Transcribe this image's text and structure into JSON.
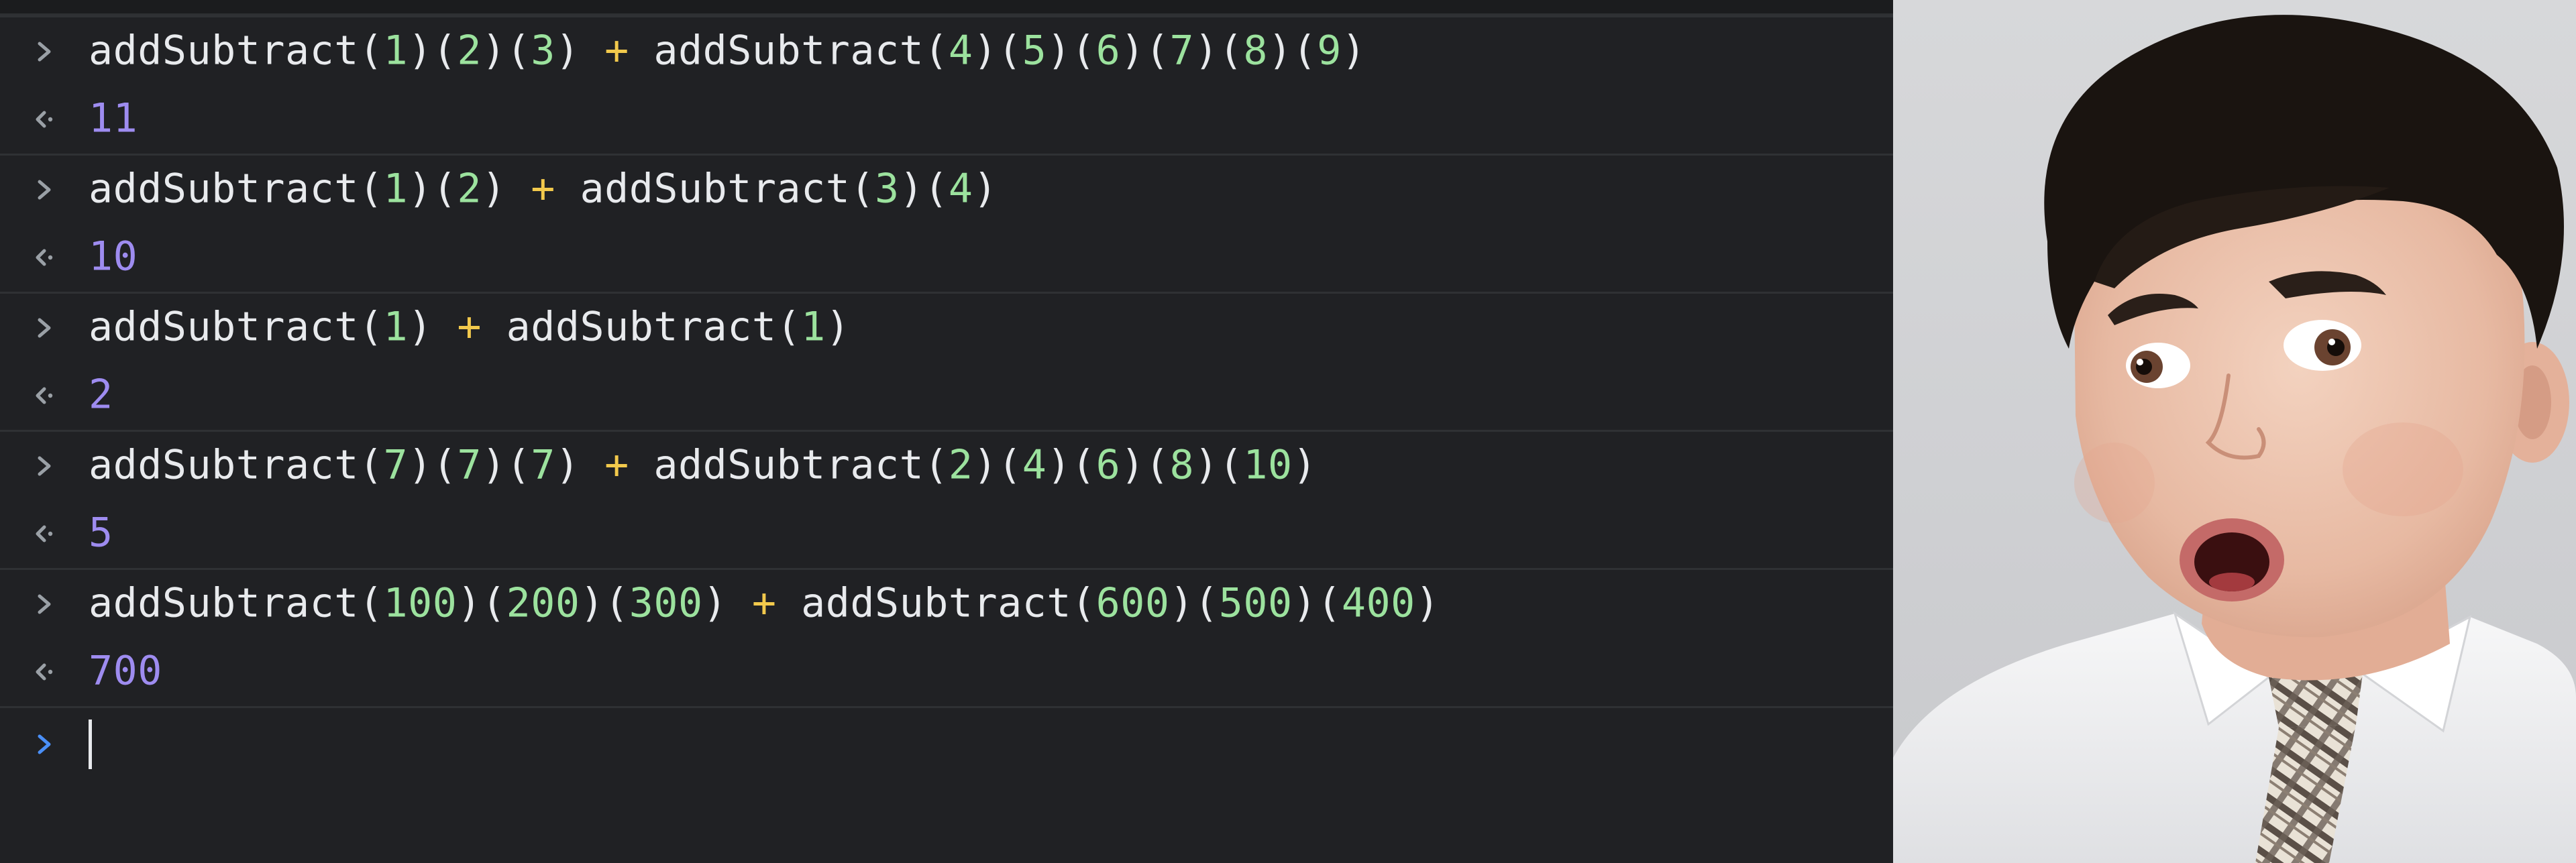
{
  "console": {
    "entries": [
      {
        "input": [
          {
            "t": "fn",
            "v": "addSubtract"
          },
          {
            "t": "paren",
            "v": "("
          },
          {
            "t": "num",
            "v": "1"
          },
          {
            "t": "paren",
            "v": ")"
          },
          {
            "t": "paren",
            "v": "("
          },
          {
            "t": "num",
            "v": "2"
          },
          {
            "t": "paren",
            "v": ")"
          },
          {
            "t": "paren",
            "v": "("
          },
          {
            "t": "num",
            "v": "3"
          },
          {
            "t": "paren",
            "v": ")"
          },
          {
            "t": "op",
            "v": " + "
          },
          {
            "t": "fn",
            "v": "addSubtract"
          },
          {
            "t": "paren",
            "v": "("
          },
          {
            "t": "num",
            "v": "4"
          },
          {
            "t": "paren",
            "v": ")"
          },
          {
            "t": "paren",
            "v": "("
          },
          {
            "t": "num",
            "v": "5"
          },
          {
            "t": "paren",
            "v": ")"
          },
          {
            "t": "paren",
            "v": "("
          },
          {
            "t": "num",
            "v": "6"
          },
          {
            "t": "paren",
            "v": ")"
          },
          {
            "t": "paren",
            "v": "("
          },
          {
            "t": "num",
            "v": "7"
          },
          {
            "t": "paren",
            "v": ")"
          },
          {
            "t": "paren",
            "v": "("
          },
          {
            "t": "num",
            "v": "8"
          },
          {
            "t": "paren",
            "v": ")"
          },
          {
            "t": "paren",
            "v": "("
          },
          {
            "t": "num",
            "v": "9"
          },
          {
            "t": "paren",
            "v": ")"
          }
        ],
        "output": "11"
      },
      {
        "input": [
          {
            "t": "fn",
            "v": "addSubtract"
          },
          {
            "t": "paren",
            "v": "("
          },
          {
            "t": "num",
            "v": "1"
          },
          {
            "t": "paren",
            "v": ")"
          },
          {
            "t": "paren",
            "v": "("
          },
          {
            "t": "num",
            "v": "2"
          },
          {
            "t": "paren",
            "v": ")"
          },
          {
            "t": "op",
            "v": " + "
          },
          {
            "t": "fn",
            "v": "addSubtract"
          },
          {
            "t": "paren",
            "v": "("
          },
          {
            "t": "num",
            "v": "3"
          },
          {
            "t": "paren",
            "v": ")"
          },
          {
            "t": "paren",
            "v": "("
          },
          {
            "t": "num",
            "v": "4"
          },
          {
            "t": "paren",
            "v": ")"
          }
        ],
        "output": "10"
      },
      {
        "input": [
          {
            "t": "fn",
            "v": "addSubtract"
          },
          {
            "t": "paren",
            "v": "("
          },
          {
            "t": "num",
            "v": "1"
          },
          {
            "t": "paren",
            "v": ")"
          },
          {
            "t": "op",
            "v": " + "
          },
          {
            "t": "fn",
            "v": "addSubtract"
          },
          {
            "t": "paren",
            "v": "("
          },
          {
            "t": "num",
            "v": "1"
          },
          {
            "t": "paren",
            "v": ")"
          }
        ],
        "output": "2"
      },
      {
        "input": [
          {
            "t": "fn",
            "v": "addSubtract"
          },
          {
            "t": "paren",
            "v": "("
          },
          {
            "t": "num",
            "v": "7"
          },
          {
            "t": "paren",
            "v": ")"
          },
          {
            "t": "paren",
            "v": "("
          },
          {
            "t": "num",
            "v": "7"
          },
          {
            "t": "paren",
            "v": ")"
          },
          {
            "t": "paren",
            "v": "("
          },
          {
            "t": "num",
            "v": "7"
          },
          {
            "t": "paren",
            "v": ")"
          },
          {
            "t": "op",
            "v": " + "
          },
          {
            "t": "fn",
            "v": "addSubtract"
          },
          {
            "t": "paren",
            "v": "("
          },
          {
            "t": "num",
            "v": "2"
          },
          {
            "t": "paren",
            "v": ")"
          },
          {
            "t": "paren",
            "v": "("
          },
          {
            "t": "num",
            "v": "4"
          },
          {
            "t": "paren",
            "v": ")"
          },
          {
            "t": "paren",
            "v": "("
          },
          {
            "t": "num",
            "v": "6"
          },
          {
            "t": "paren",
            "v": ")"
          },
          {
            "t": "paren",
            "v": "("
          },
          {
            "t": "num",
            "v": "8"
          },
          {
            "t": "paren",
            "v": ")"
          },
          {
            "t": "paren",
            "v": "("
          },
          {
            "t": "num",
            "v": "10"
          },
          {
            "t": "paren",
            "v": ")"
          }
        ],
        "output": "5"
      },
      {
        "input": [
          {
            "t": "fn",
            "v": "addSubtract"
          },
          {
            "t": "paren",
            "v": "("
          },
          {
            "t": "num",
            "v": "100"
          },
          {
            "t": "paren",
            "v": ")"
          },
          {
            "t": "paren",
            "v": "("
          },
          {
            "t": "num",
            "v": "200"
          },
          {
            "t": "paren",
            "v": ")"
          },
          {
            "t": "paren",
            "v": "("
          },
          {
            "t": "num",
            "v": "300"
          },
          {
            "t": "paren",
            "v": ")"
          },
          {
            "t": "op",
            "v": " + "
          },
          {
            "t": "fn",
            "v": "addSubtract"
          },
          {
            "t": "paren",
            "v": "("
          },
          {
            "t": "num",
            "v": "600"
          },
          {
            "t": "paren",
            "v": ")"
          },
          {
            "t": "paren",
            "v": "("
          },
          {
            "t": "num",
            "v": "500"
          },
          {
            "t": "paren",
            "v": ")"
          },
          {
            "t": "paren",
            "v": "("
          },
          {
            "t": "num",
            "v": "400"
          },
          {
            "t": "paren",
            "v": ")"
          }
        ],
        "output": "700"
      }
    ],
    "prompt_value": "",
    "icons": {
      "input": "chevron-right-icon",
      "output": "return-arrow-icon",
      "prompt": "chevron-right-icon"
    }
  },
  "colors": {
    "background": "#202124",
    "default_text": "#e8eaed",
    "number": "#9ce29e",
    "operator": "#f2c94c",
    "result": "#9e8cf0",
    "prompt_chevron": "#4a8ff7",
    "divider": "#2f3134"
  },
  "photo": {
    "subject": "surprised-boy-photo"
  }
}
